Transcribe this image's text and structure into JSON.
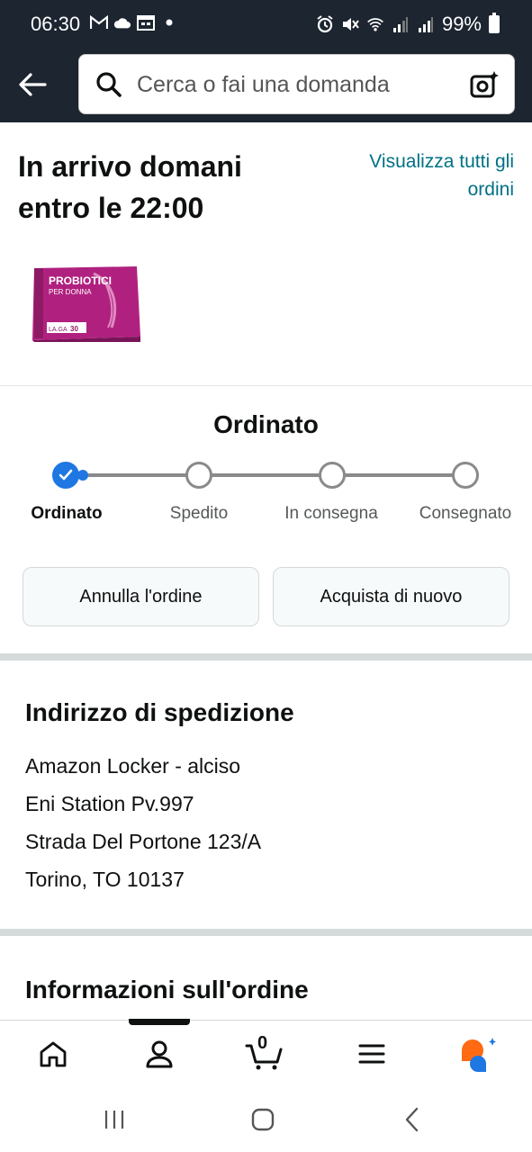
{
  "status_bar": {
    "time": "06:30",
    "battery": "99%"
  },
  "header": {
    "search_placeholder": "Cerca o fai una domanda"
  },
  "delivery": {
    "title": "In arrivo domani entro le 22:00",
    "view_all": "Visualizza tutti gli ordini"
  },
  "product_image": {
    "brand": "PROBIOTICI",
    "sub": "PER DONNA",
    "tag": "LA.GA",
    "count": "30"
  },
  "progress": {
    "current_status": "Ordinato",
    "steps": [
      {
        "label": "Ordinato"
      },
      {
        "label": "Spedito"
      },
      {
        "label": "In consegna"
      },
      {
        "label": "Consegnato"
      }
    ],
    "completed_steps": 1
  },
  "actions": {
    "cancel_label": "Annulla l'ordine",
    "buy_again_label": "Acquista di nuovo"
  },
  "address": {
    "title": "Indirizzo di spedizione",
    "lines": [
      "Amazon Locker - alciso",
      "Eni Station Pv.997",
      "Strada Del Portone 123/A",
      "Torino, TO 10137"
    ]
  },
  "order_info": {
    "title": "Informazioni sull'ordine"
  },
  "bottom_nav": {
    "cart_count": "0"
  },
  "colors": {
    "header_bg": "#1c2530",
    "link": "#007185",
    "progress_active": "#1e77e2",
    "assistant_orange": "#ff6a13",
    "assistant_blue": "#1e77e2"
  }
}
